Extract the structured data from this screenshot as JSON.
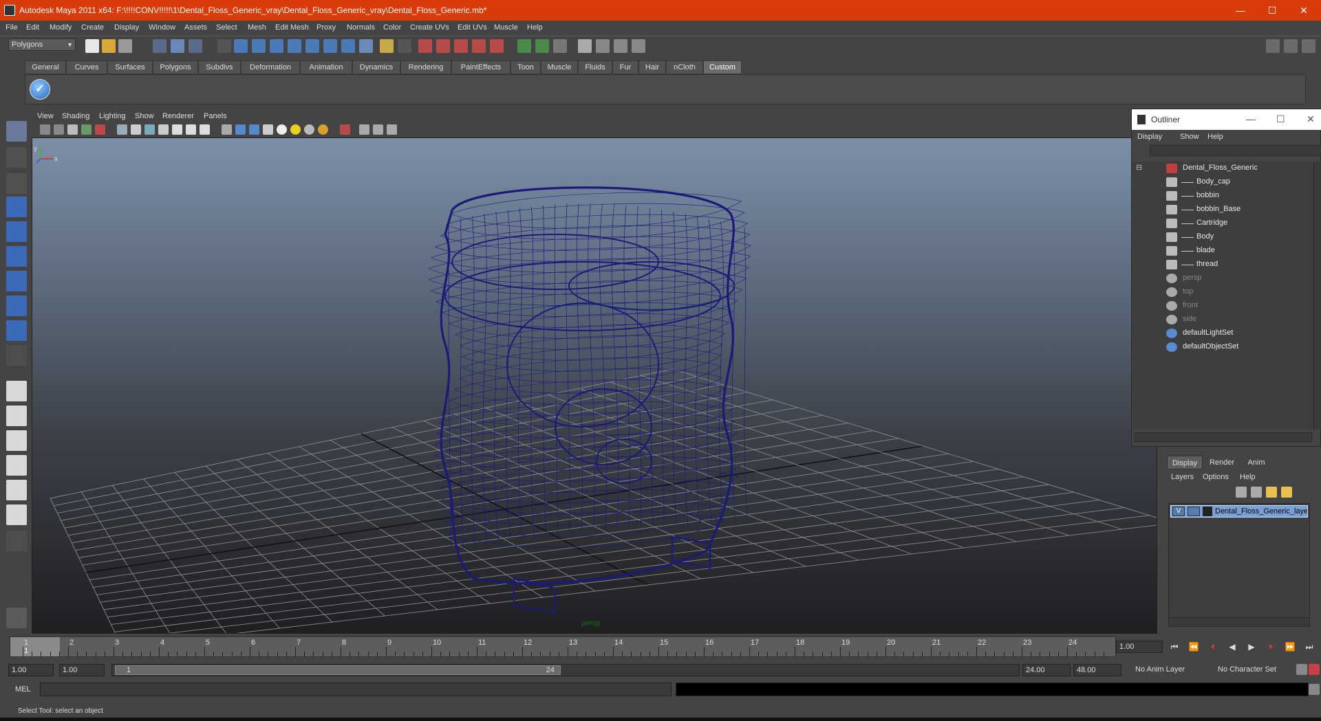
{
  "window": {
    "title": "Autodesk Maya 2011 x64: F:\\!!!!CONV!!!!!\\1\\Dental_Floss_Generic_vray\\Dental_Floss_Generic_vray\\Dental_Floss_Generic.mb*",
    "minimize": "—",
    "maximize": "☐",
    "close": "✕"
  },
  "menubar": [
    "File",
    "Edit",
    "Modify",
    "Create",
    "Display",
    "Window",
    "Assets",
    "Select",
    "Mesh",
    "Edit Mesh",
    "Proxy",
    "Normals",
    "Color",
    "Create UVs",
    "Edit UVs",
    "Muscle",
    "Help"
  ],
  "statusline": {
    "mode": "Polygons"
  },
  "shelf": {
    "tabs": [
      "General",
      "Curves",
      "Surfaces",
      "Polygons",
      "Subdivs",
      "Deformation",
      "Animation",
      "Dynamics",
      "Rendering",
      "PaintEffects",
      "Toon",
      "Muscle",
      "Fluids",
      "Fur",
      "Hair",
      "nCloth",
      "Custom"
    ],
    "active_tab": "Custom",
    "icon_glyph": "✓"
  },
  "panel": {
    "menu": [
      "View",
      "Shading",
      "Lighting",
      "Show",
      "Renderer",
      "Panels"
    ],
    "camera": "persp",
    "axis_x": "x",
    "axis_y": "y",
    "wire_color": "#1a1a7a"
  },
  "outliner": {
    "title": "Outliner",
    "menu": [
      "Display",
      "Show",
      "Help"
    ],
    "items": [
      {
        "label": "Dental_Floss_Generic",
        "icon": "transform-icon",
        "dim": false
      },
      {
        "label": "Body_cap",
        "icon": "mesh-icon",
        "dim": false
      },
      {
        "label": "bobbin",
        "icon": "mesh-icon",
        "dim": false
      },
      {
        "label": "bobbin_Base",
        "icon": "mesh-icon",
        "dim": false
      },
      {
        "label": "Cartridge",
        "icon": "mesh-icon",
        "dim": false
      },
      {
        "label": "Body",
        "icon": "mesh-icon",
        "dim": false
      },
      {
        "label": "blade",
        "icon": "mesh-icon",
        "dim": false
      },
      {
        "label": "thread",
        "icon": "mesh-icon",
        "dim": false
      },
      {
        "label": "persp",
        "icon": "camera-icon",
        "dim": true
      },
      {
        "label": "top",
        "icon": "camera-icon",
        "dim": true
      },
      {
        "label": "front",
        "icon": "camera-icon",
        "dim": true
      },
      {
        "label": "side",
        "icon": "camera-icon",
        "dim": true
      },
      {
        "label": "defaultLightSet",
        "icon": "set-icon",
        "dim": false
      },
      {
        "label": "defaultObjectSet",
        "icon": "set-icon",
        "dim": false
      }
    ]
  },
  "layers": {
    "tabs": [
      "Display",
      "Render",
      "Anim"
    ],
    "active_tab": "Display",
    "menu": [
      "Layers",
      "Options",
      "Help"
    ],
    "layer": {
      "visible": "V",
      "name": "Dental_Floss_Generic_layer"
    }
  },
  "timeline": {
    "ticks": [
      "1",
      "2",
      "3",
      "4",
      "5",
      "6",
      "7",
      "8",
      "9",
      "10",
      "11",
      "12",
      "13",
      "14",
      "15",
      "16",
      "17",
      "18",
      "19",
      "20",
      "21",
      "22",
      "23",
      "24"
    ],
    "current_frame_marker": "1",
    "current_frame": "1.00"
  },
  "range": {
    "start": "1.00",
    "playback_start": "1.00",
    "handle_start": "1",
    "handle_end": "24",
    "playback_end": "24.00",
    "end": "48.00",
    "anim_layer": "No Anim Layer",
    "character_set": "No Character Set"
  },
  "command": {
    "label": "MEL"
  },
  "help": {
    "text": "Select Tool: select an object"
  }
}
